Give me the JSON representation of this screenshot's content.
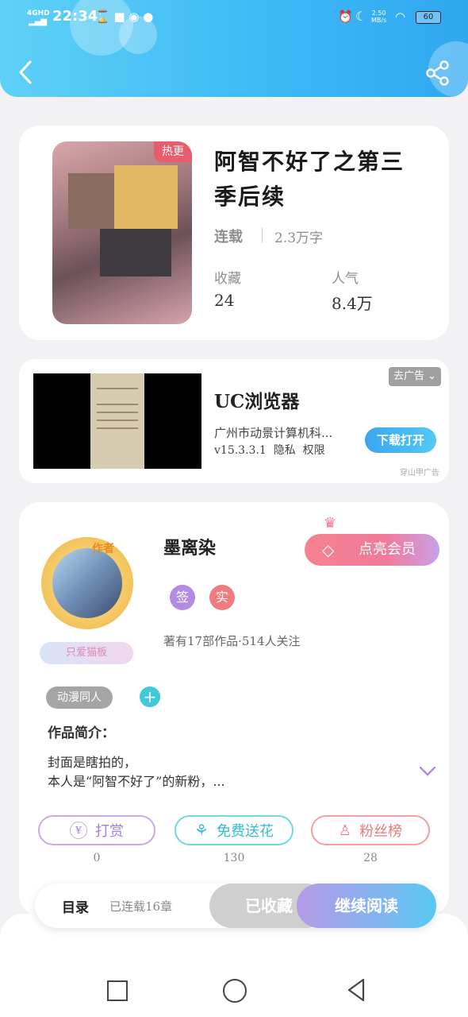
{
  "status_bar": {
    "network": "4GHD",
    "time": "22:34",
    "speed": "2.50\nMB/s",
    "battery": "60"
  },
  "book": {
    "title": "阿智不好了之第三季后续",
    "badge": "热更",
    "status": "连载",
    "word_count": "2.3万字",
    "favorites_label": "收藏",
    "favorites_value": "24",
    "popularity_label": "人气",
    "popularity_value": "8.4万"
  },
  "ad": {
    "go_ad_label": "去广告",
    "app_name": "UC浏览器",
    "company": "广州市动景计算机科...",
    "version": "v15.3.3.1",
    "privacy": "隐私",
    "permissions": "权限",
    "download_button": "下载打开",
    "source": "穿山甲广告"
  },
  "author": {
    "name": "墨离染",
    "avatar_badge": "作者",
    "nickname_ribbon": "只爱猫板",
    "vip_button": "点亮会员",
    "tag_sign": "签",
    "tag_real": "实",
    "stats": "著有17部作品·514人关注",
    "category_tag": "动漫同人"
  },
  "intro": {
    "label": "作品简介：",
    "line1": "封面是瞎拍的，",
    "line2": "本人是“阿智不好了”的新粉，..."
  },
  "actions": {
    "reward_label": "打赏",
    "reward_count": "0",
    "flower_label": "免费送花",
    "flower_count": "130",
    "fans_label": "粉丝榜",
    "fans_count": "28"
  },
  "bottom": {
    "catalog_label": "目录",
    "catalog_info": "已连载16章",
    "collected_label": "已收藏",
    "read_label": "继续阅读"
  },
  "colors": {
    "header_blue": "#3cb8f5",
    "vip_pink": "#f07a8d",
    "purple": "#b48be3",
    "teal": "#3fc9d9",
    "coral": "#ef7d7d"
  }
}
